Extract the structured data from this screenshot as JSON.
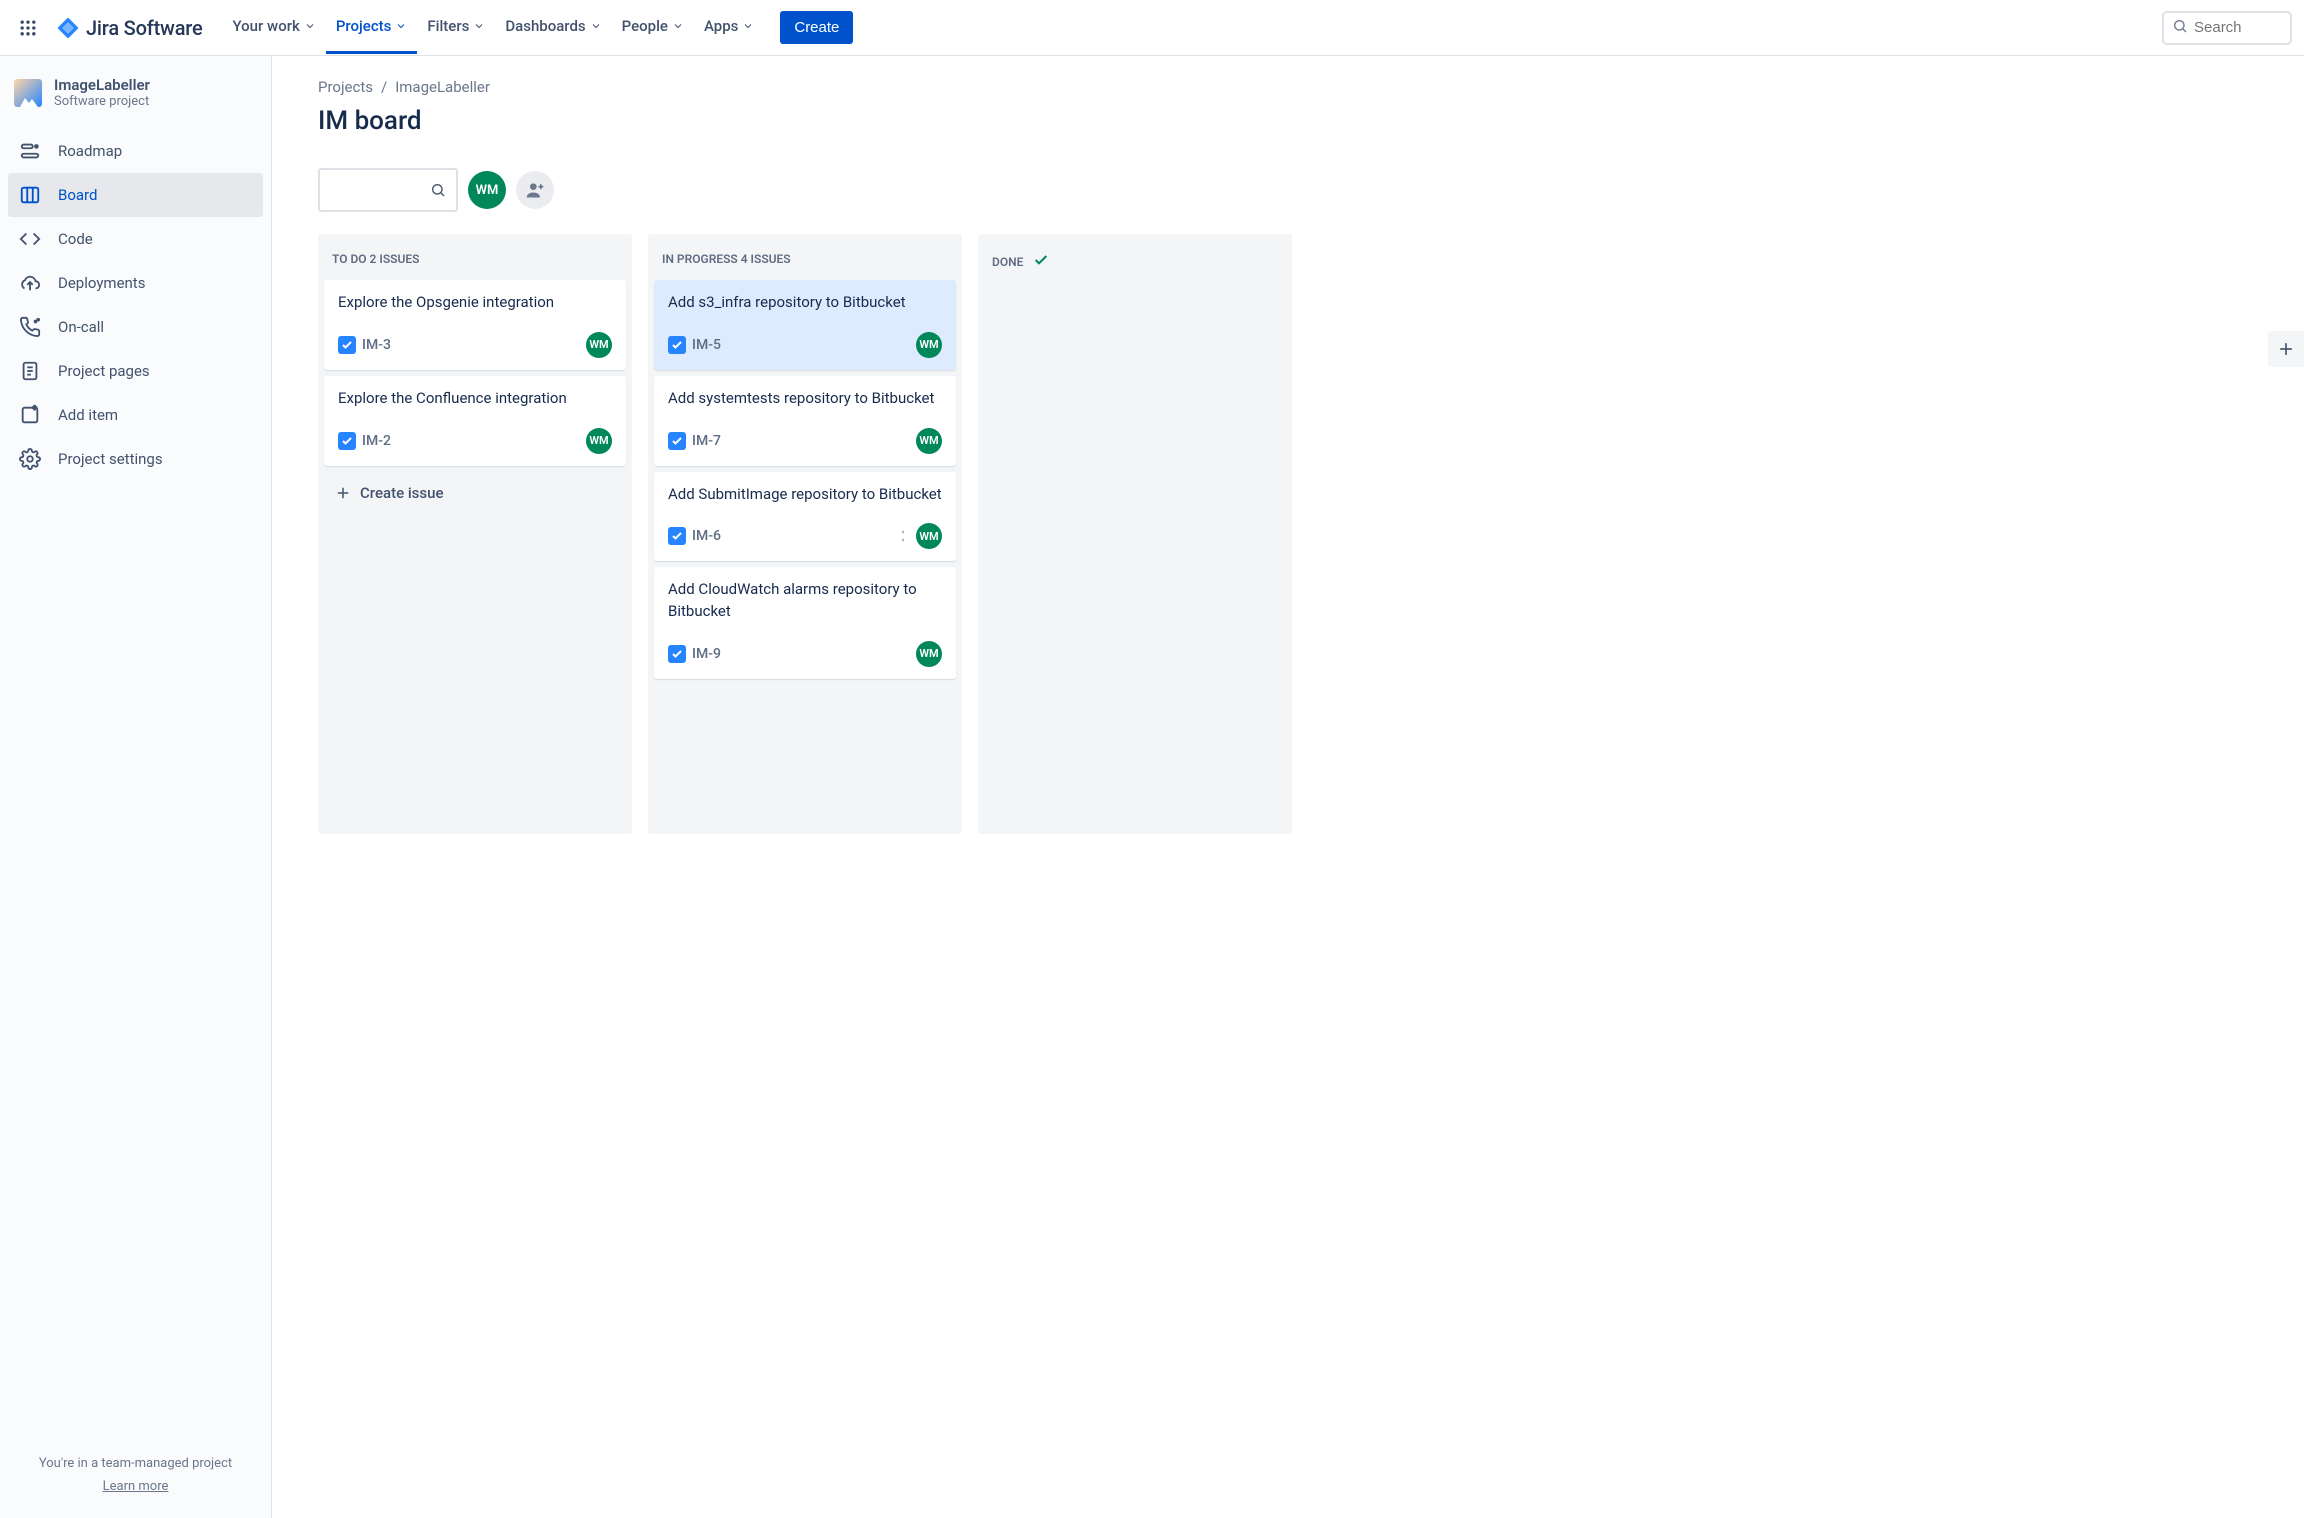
{
  "nav": {
    "product": "Jira Software",
    "items": [
      "Your work",
      "Projects",
      "Filters",
      "Dashboards",
      "People",
      "Apps"
    ],
    "activeIndex": 1,
    "create": "Create",
    "searchPlaceholder": "Search"
  },
  "sidebar": {
    "project": {
      "name": "ImageLabeller",
      "type": "Software project"
    },
    "items": [
      {
        "label": "Roadmap",
        "icon": "roadmap"
      },
      {
        "label": "Board",
        "icon": "board",
        "selected": true
      },
      {
        "label": "Code",
        "icon": "code"
      },
      {
        "label": "Deployments",
        "icon": "cloud-upload"
      },
      {
        "label": "On-call",
        "icon": "phone"
      },
      {
        "label": "Project pages",
        "icon": "page"
      },
      {
        "label": "Add item",
        "icon": "add-item"
      },
      {
        "label": "Project settings",
        "icon": "gear"
      }
    ],
    "footer": {
      "note": "You're in a team-managed project",
      "learn": "Learn more"
    }
  },
  "breadcrumb": [
    "Projects",
    "ImageLabeller"
  ],
  "pageTitle": "IM board",
  "assignee": "WM",
  "columns": [
    {
      "name": "TO DO",
      "count": "2 ISSUES",
      "done": false,
      "showCreate": true,
      "cards": [
        {
          "title": "Explore the Opsgenie integration",
          "key": "IM-3",
          "avatar": "WM"
        },
        {
          "title": "Explore the Confluence integration",
          "key": "IM-2",
          "avatar": "WM"
        }
      ]
    },
    {
      "name": "IN PROGRESS",
      "count": "4 ISSUES",
      "done": false,
      "showCreate": false,
      "cards": [
        {
          "title": "Add s3_infra repository to Bitbucket",
          "key": "IM-5",
          "avatar": "WM",
          "selected": true
        },
        {
          "title": "Add systemtests repository to Bitbucket",
          "key": "IM-7",
          "avatar": "WM"
        },
        {
          "title": "Add SubmitImage repository to Bitbucket",
          "key": "IM-6",
          "avatar": "WM",
          "priority": true
        },
        {
          "title": "Add CloudWatch alarms repository to Bitbucket",
          "key": "IM-9",
          "avatar": "WM"
        }
      ]
    },
    {
      "name": "DONE",
      "count": "",
      "done": true,
      "showCreate": false,
      "cards": []
    }
  ],
  "createIssue": "Create issue"
}
